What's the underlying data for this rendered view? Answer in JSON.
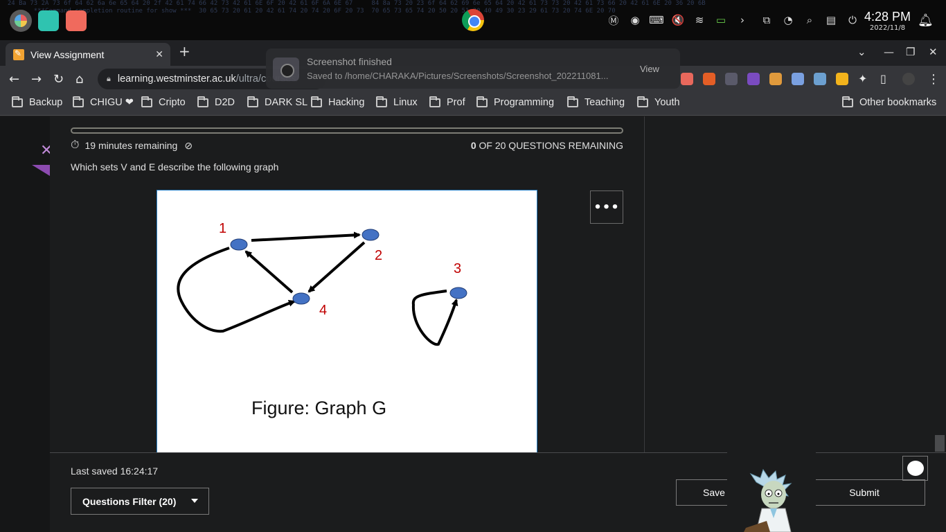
{
  "system": {
    "time": "4:28 PM",
    "date": "2022/11/8"
  },
  "toast": {
    "title": "Screenshot finished",
    "message": "Saved to /home/CHARAKA/Pictures/Screenshots/Screenshot_202211081...",
    "action": "View"
  },
  "browser": {
    "tab_title": "View Assignment",
    "url_host": "learning.westminster.ac.uk",
    "url_path": "/ultra/courses/",
    "bookmarks": [
      "Backup",
      "CHIGU ❤",
      "Cripto",
      "D2D",
      "DARK SL",
      "Hacking",
      "Linux",
      "Prof",
      "Programming",
      "Teaching",
      "Youth"
    ],
    "other_bookmarks": "Other bookmarks"
  },
  "assignment": {
    "timer_text": "19 minutes remaining",
    "remaining_count": "0",
    "remaining_text": "OF 20 QUESTIONS REMAINING",
    "question": "Which sets V and E describe the following graph",
    "more_label": "•••",
    "figure": {
      "caption": "Figure: Graph G",
      "node_labels": [
        "1",
        "2",
        "3",
        "4"
      ],
      "node_color": "#4472c4",
      "label_color": "#c00000"
    }
  },
  "footer": {
    "last_saved": "Last saved 16:24:17",
    "filter_label": "Questions Filter (20)",
    "save_label": "Save",
    "submit_label": "Submit"
  }
}
